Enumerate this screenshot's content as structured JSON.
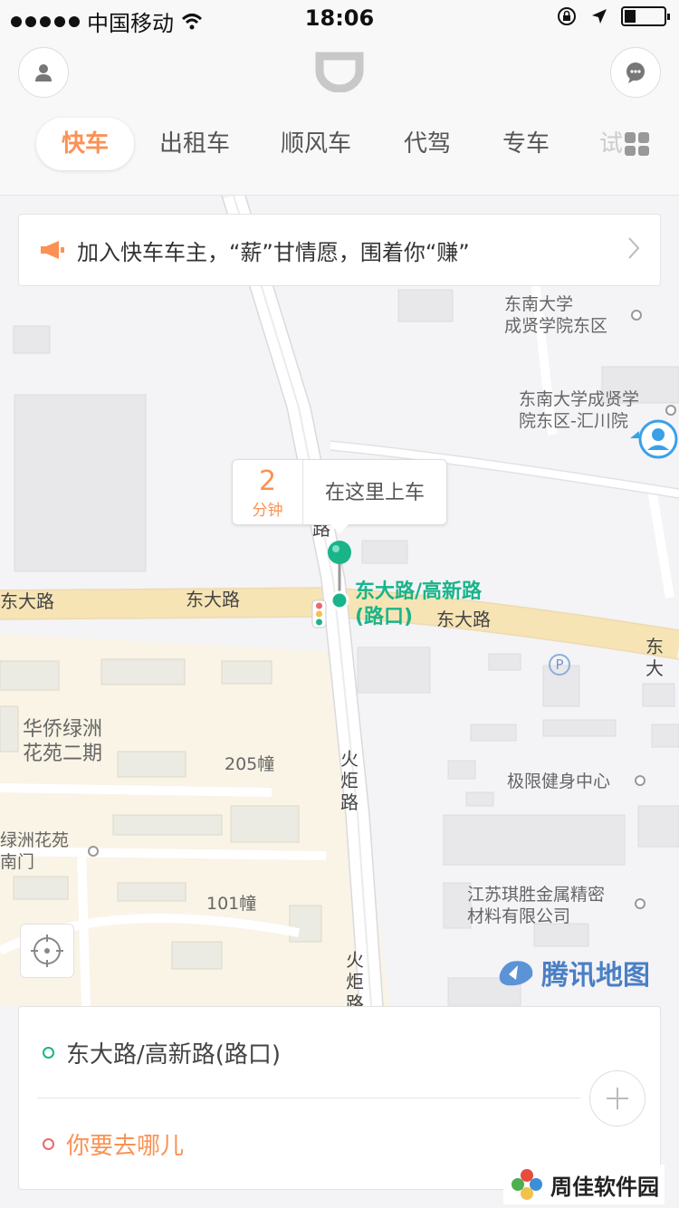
{
  "status_bar": {
    "carrier": "中国移动",
    "time": "18:06"
  },
  "header": {
    "tabs": [
      {
        "label": "快车",
        "active": true
      },
      {
        "label": "出租车"
      },
      {
        "label": "顺风车"
      },
      {
        "label": "代驾"
      },
      {
        "label": "专车"
      },
      {
        "label": "试"
      }
    ]
  },
  "banner": {
    "text": "加入快车车主，“薪”甘情愿，围着你“赚”"
  },
  "map": {
    "labels": {
      "seu_east": "东南大学\n成贤学院东区",
      "seu_huichuan": "东南大学成贤学\n院东区-汇川院",
      "dongda_left": "东大路",
      "dongda_mid": "东大路",
      "dongda_right": "东大路",
      "dongda_far": "东大",
      "dongda_edge": "东大路",
      "lu_stub": "路",
      "huaqiao": "华侨绿洲\n花苑二期",
      "bld205": "205幢",
      "huoju1": "火\n炬\n路",
      "fitness": "极限健身中心",
      "lvzhou_south": "绿洲花苑\n南门",
      "bld101": "101幢",
      "jiangsu": "江苏琪胜金属精密\n材料有限公司",
      "huoju2": "火\n炬\n路",
      "parking": "P"
    },
    "eta_minutes": "2",
    "eta_unit": "分钟",
    "pickup_prompt": "在这里上车",
    "pickup_label": "东大路/高新路\n(路口)",
    "brand": "腾讯地图"
  },
  "trip": {
    "origin": "东大路/高新路(路口)",
    "destination_placeholder": "你要去哪儿"
  },
  "watermark": "周佳软件园",
  "colors": {
    "accent": "#fc9153",
    "pickup_green": "#19b48a",
    "dest_red": "#e86a6a"
  }
}
